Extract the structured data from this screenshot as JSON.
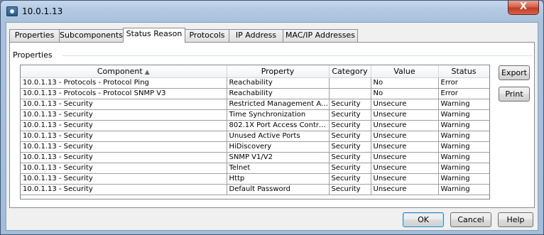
{
  "window": {
    "title": "10.0.1.13",
    "close_label": "X"
  },
  "tabs": [
    {
      "label": "Properties"
    },
    {
      "label": "Subcomponents"
    },
    {
      "label": "Status Reason"
    },
    {
      "label": "Protocols"
    },
    {
      "label": "IP Address"
    },
    {
      "label": "MAC/IP Addresses"
    }
  ],
  "active_tab": "Status Reason",
  "group": {
    "label": "Properties"
  },
  "table": {
    "columns": [
      "Component",
      "Property",
      "Category",
      "Value",
      "Status"
    ],
    "sorted_column": "Component",
    "rows": [
      [
        "10.0.1.13 - Protocols - Protocol Ping",
        "Reachability",
        "",
        "No",
        "Error"
      ],
      [
        "10.0.1.13 - Protocols - Protocol SNMP V3",
        "Reachability",
        "",
        "No",
        "Error"
      ],
      [
        "10.0.1.13 - Security",
        "Restricted Management Acc...",
        "Security",
        "Unsecure",
        "Warning"
      ],
      [
        "10.0.1.13 - Security",
        "Time Synchronization",
        "Security",
        "Unsecure",
        "Warning"
      ],
      [
        "10.0.1.13 - Security",
        "802.1X Port Access Control ...",
        "Security",
        "Unsecure",
        "Warning"
      ],
      [
        "10.0.1.13 - Security",
        "Unused Active Ports",
        "Security",
        "Unsecure",
        "Warning"
      ],
      [
        "10.0.1.13 - Security",
        "HiDiscovery",
        "Security",
        "Unsecure",
        "Warning"
      ],
      [
        "10.0.1.13 - Security",
        "SNMP V1/V2",
        "Security",
        "Unsecure",
        "Warning"
      ],
      [
        "10.0.1.13 - Security",
        "Telnet",
        "Security",
        "Unsecure",
        "Warning"
      ],
      [
        "10.0.1.13 - Security",
        "Http",
        "Security",
        "Unsecure",
        "Warning"
      ],
      [
        "10.0.1.13 - Security",
        "Default Password",
        "Security",
        "Unsecure",
        "Warning"
      ]
    ]
  },
  "side_buttons": {
    "export_label": "Export",
    "print_label": "Print"
  },
  "footer_buttons": {
    "ok_label": "OK",
    "cancel_label": "Cancel",
    "help_label": "Help"
  }
}
